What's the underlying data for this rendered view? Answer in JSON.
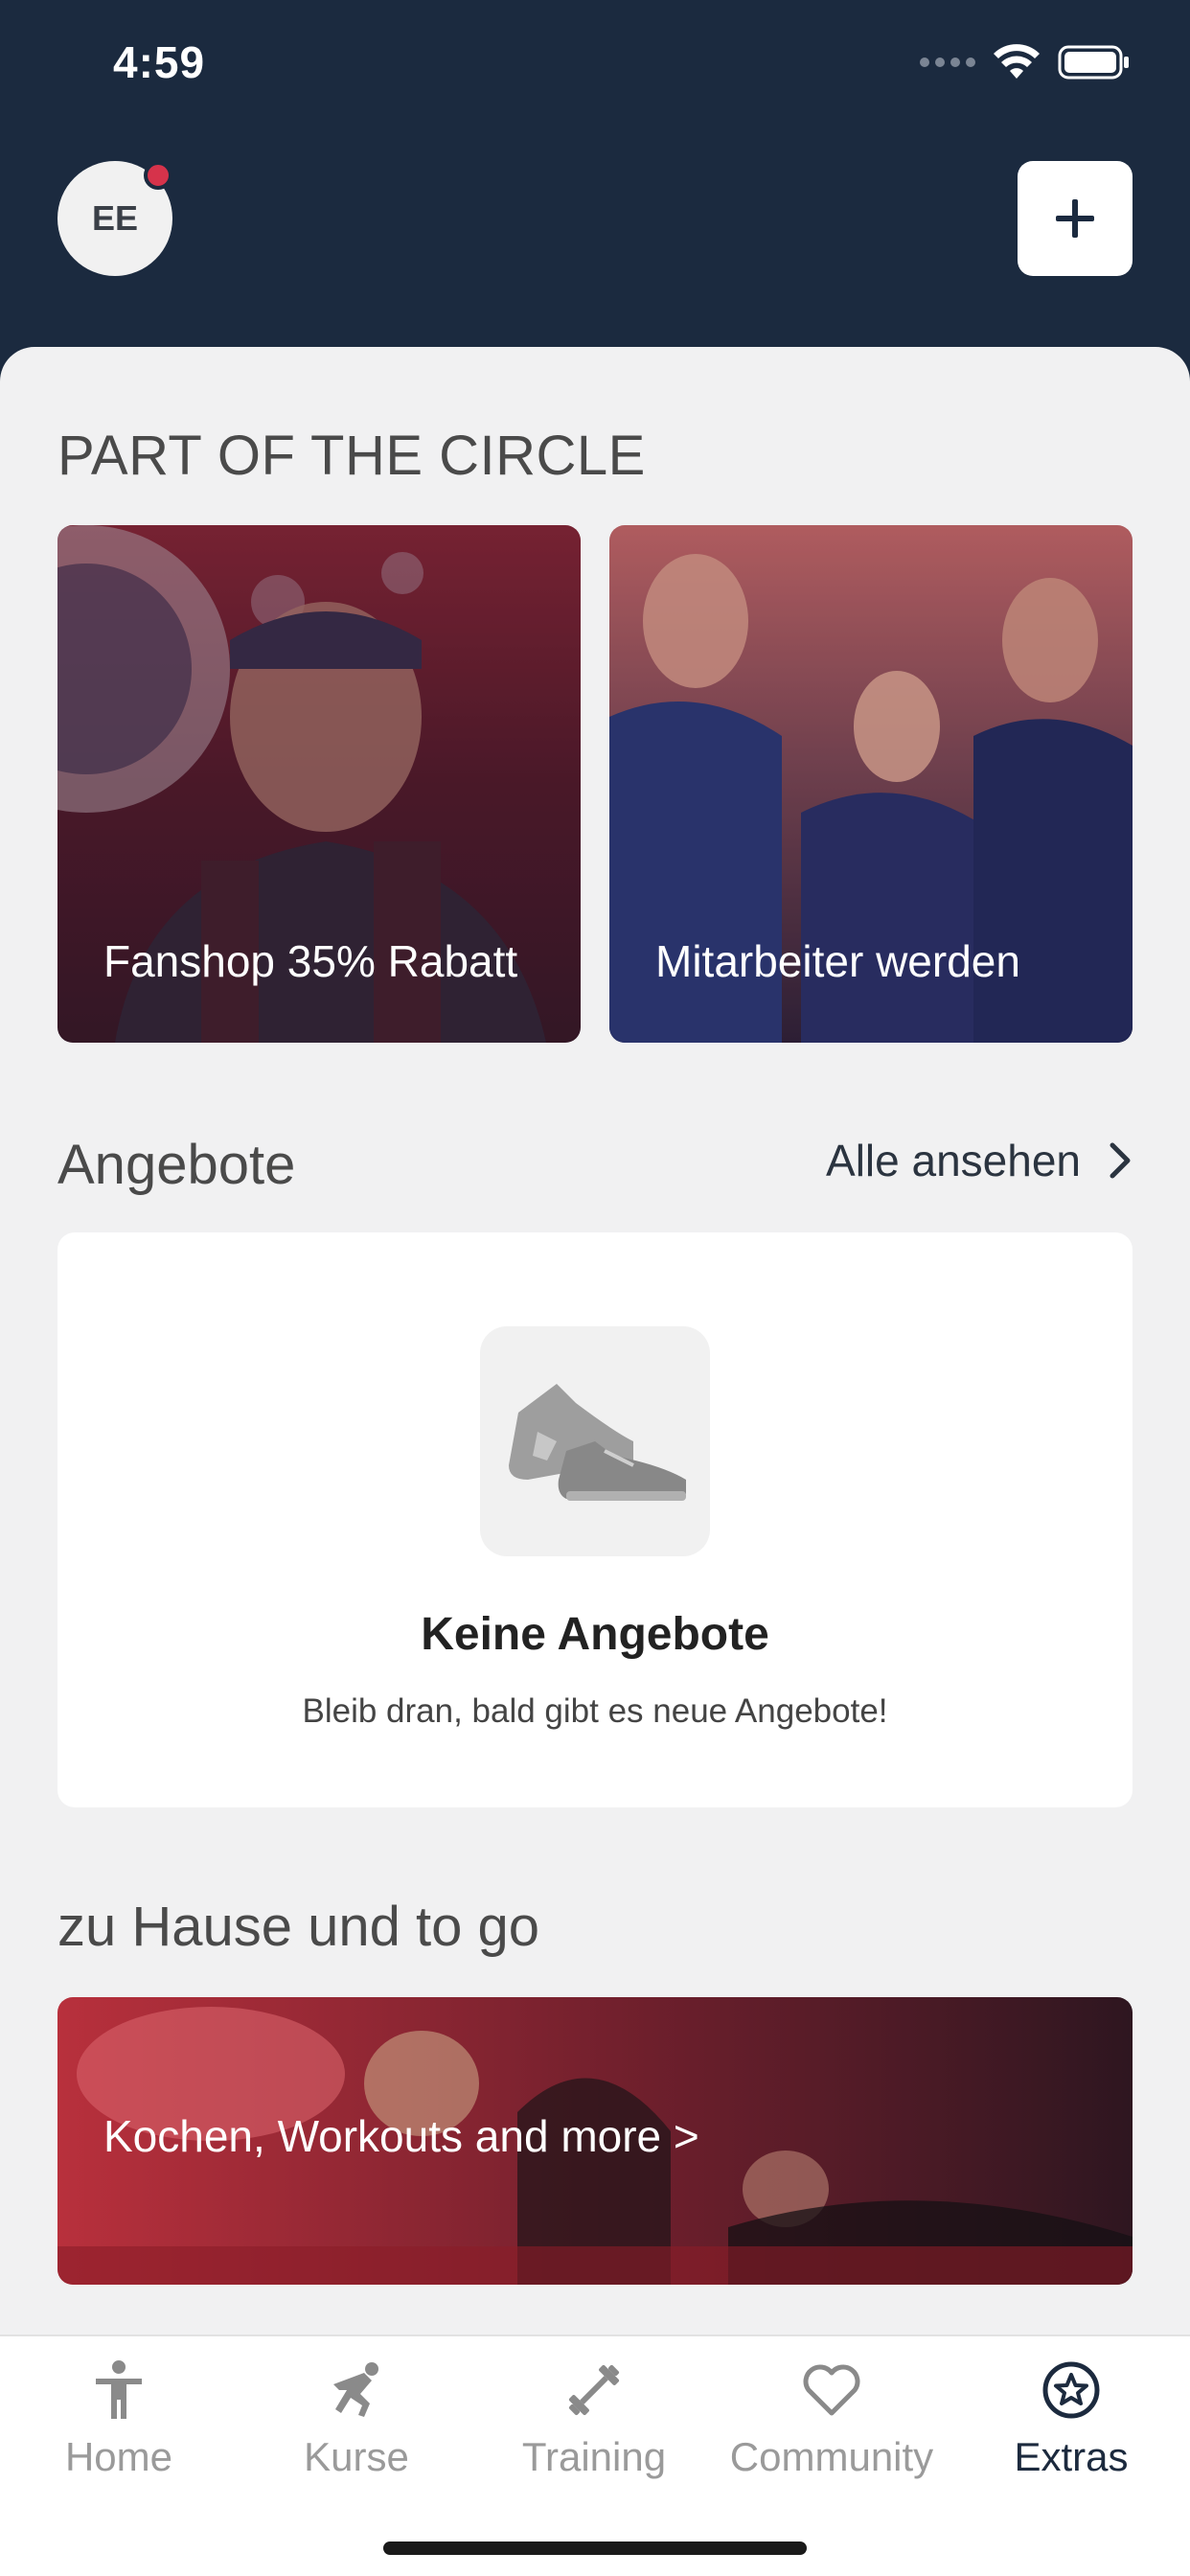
{
  "status": {
    "time": "4:59"
  },
  "header": {
    "avatar_initials": "EE"
  },
  "circle_section": {
    "title": "PART OF THE CIRCLE",
    "cards": [
      {
        "label": "Fanshop 35% Rabatt"
      },
      {
        "label": "Mitarbeiter werden"
      }
    ]
  },
  "offers_section": {
    "title": "Angebote",
    "see_all": "Alle ansehen",
    "empty_title": "Keine Angebote",
    "empty_subtitle": "Bleib dran, bald gibt es neue Angebote!"
  },
  "home_section": {
    "title": "zu Hause und to go",
    "card_label": "Kochen, Workouts and more >"
  },
  "tabs": [
    {
      "label": "Home",
      "icon": "person-icon"
    },
    {
      "label": "Kurse",
      "icon": "running-icon"
    },
    {
      "label": "Training",
      "icon": "dumbbell-icon"
    },
    {
      "label": "Community",
      "icon": "heart-icon"
    },
    {
      "label": "Extras",
      "icon": "star-circle-icon",
      "active": true
    }
  ],
  "colors": {
    "header": "#1b2a3f",
    "background": "#f1f1f2",
    "accent_red": "#d6334b",
    "active_tab": "#1c2a3e"
  }
}
